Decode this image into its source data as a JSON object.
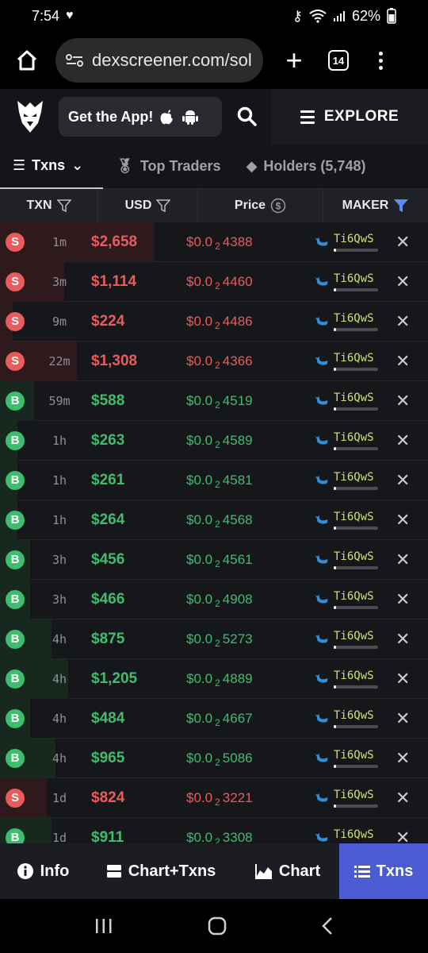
{
  "status_bar": {
    "time": "7:54",
    "battery": "62%"
  },
  "browser": {
    "url": "dexscreener.com/sol",
    "tab_count": "14"
  },
  "header": {
    "get_app_label": "Get the App!",
    "explore_label": "EXPLORE"
  },
  "tabs": [
    {
      "label": "Txns"
    },
    {
      "label": "Top Traders"
    },
    {
      "label": "Holders (5,748)"
    }
  ],
  "table": {
    "columns": [
      "TXN",
      "USD",
      "Price",
      "MAKER"
    ],
    "rows": [
      {
        "type": "S",
        "time": "1m",
        "usd": "$2,658",
        "price_prefix": "$0.0",
        "price_sub": "2",
        "price_digits": "4388",
        "maker": "Ti6QwS",
        "volume_share": 0.36
      },
      {
        "type": "S",
        "time": "3m",
        "usd": "$1,114",
        "price_prefix": "$0.0",
        "price_sub": "2",
        "price_digits": "4460",
        "maker": "Ti6QwS",
        "volume_share": 0.15
      },
      {
        "type": "S",
        "time": "9m",
        "usd": "$224",
        "price_prefix": "$0.0",
        "price_sub": "2",
        "price_digits": "4486",
        "maker": "Ti6QwS",
        "volume_share": 0.03
      },
      {
        "type": "S",
        "time": "22m",
        "usd": "$1,308",
        "price_prefix": "$0.0",
        "price_sub": "2",
        "price_digits": "4366",
        "maker": "Ti6QwS",
        "volume_share": 0.18
      },
      {
        "type": "B",
        "time": "59m",
        "usd": "$588",
        "price_prefix": "$0.0",
        "price_sub": "2",
        "price_digits": "4519",
        "maker": "Ti6QwS",
        "volume_share": 0.08
      },
      {
        "type": "B",
        "time": "1h",
        "usd": "$263",
        "price_prefix": "$0.0",
        "price_sub": "2",
        "price_digits": "4589",
        "maker": "Ti6QwS",
        "volume_share": 0.04
      },
      {
        "type": "B",
        "time": "1h",
        "usd": "$261",
        "price_prefix": "$0.0",
        "price_sub": "2",
        "price_digits": "4581",
        "maker": "Ti6QwS",
        "volume_share": 0.04
      },
      {
        "type": "B",
        "time": "1h",
        "usd": "$264",
        "price_prefix": "$0.0",
        "price_sub": "2",
        "price_digits": "4568",
        "maker": "Ti6QwS",
        "volume_share": 0.04
      },
      {
        "type": "B",
        "time": "3h",
        "usd": "$456",
        "price_prefix": "$0.0",
        "price_sub": "2",
        "price_digits": "4561",
        "maker": "Ti6QwS",
        "volume_share": 0.07
      },
      {
        "type": "B",
        "time": "3h",
        "usd": "$466",
        "price_prefix": "$0.0",
        "price_sub": "2",
        "price_digits": "4908",
        "maker": "Ti6QwS",
        "volume_share": 0.07
      },
      {
        "type": "B",
        "time": "4h",
        "usd": "$875",
        "price_prefix": "$0.0",
        "price_sub": "2",
        "price_digits": "5273",
        "maker": "Ti6QwS",
        "volume_share": 0.12
      },
      {
        "type": "B",
        "time": "4h",
        "usd": "$1,205",
        "price_prefix": "$0.0",
        "price_sub": "2",
        "price_digits": "4889",
        "maker": "Ti6QwS",
        "volume_share": 0.16
      },
      {
        "type": "B",
        "time": "4h",
        "usd": "$484",
        "price_prefix": "$0.0",
        "price_sub": "2",
        "price_digits": "4667",
        "maker": "Ti6QwS",
        "volume_share": 0.07
      },
      {
        "type": "B",
        "time": "4h",
        "usd": "$965",
        "price_prefix": "$0.0",
        "price_sub": "2",
        "price_digits": "5086",
        "maker": "Ti6QwS",
        "volume_share": 0.13
      },
      {
        "type": "S",
        "time": "1d",
        "usd": "$824",
        "price_prefix": "$0.0",
        "price_sub": "2",
        "price_digits": "3221",
        "maker": "Ti6QwS",
        "volume_share": 0.11
      },
      {
        "type": "B",
        "time": "1d",
        "usd": "$911",
        "price_prefix": "$0.0",
        "price_sub": "2",
        "price_digits": "3308",
        "maker": "Ti6QwS",
        "volume_share": 0.12
      }
    ]
  },
  "bottom_nav": [
    {
      "label": "Info",
      "icon": "info-icon"
    },
    {
      "label": "Chart+Txns",
      "icon": "split-view-icon"
    },
    {
      "label": "Chart",
      "icon": "chart-icon"
    },
    {
      "label": "Txns",
      "icon": "list-icon"
    }
  ],
  "colors": {
    "sell": "#ea5b5b",
    "buy": "#3fbd6e",
    "active_nav": "#4a5bd4",
    "maker_text": "#d8e06b"
  }
}
